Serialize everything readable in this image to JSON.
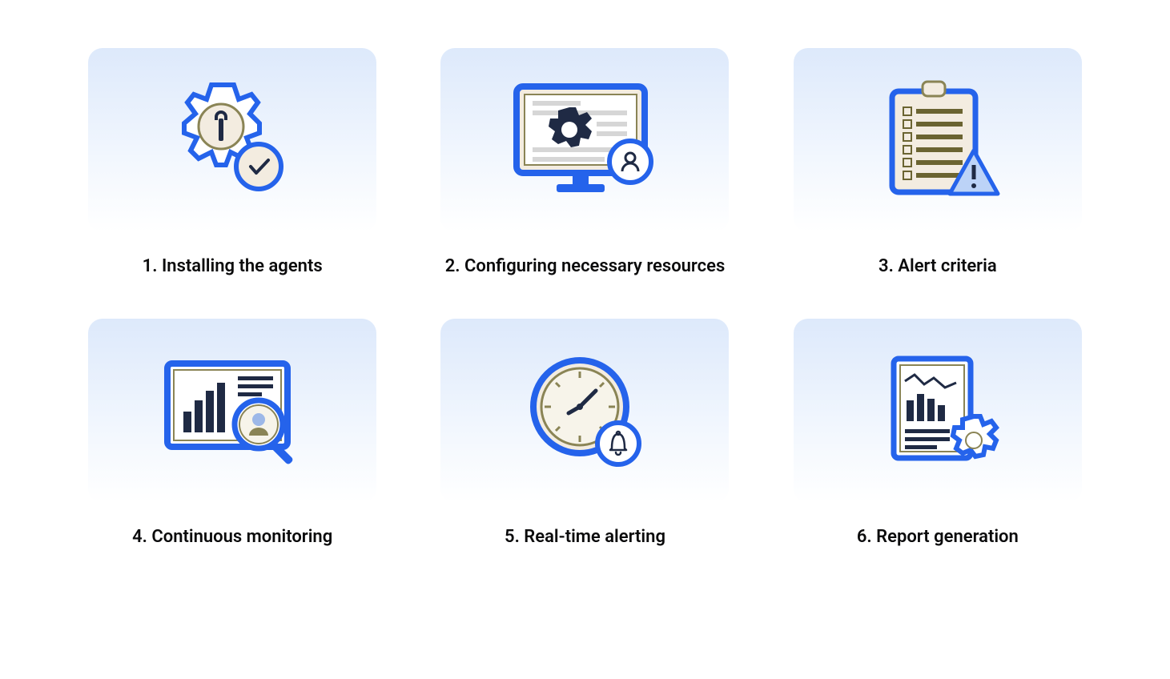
{
  "steps": [
    {
      "label": "1. Installing the agents"
    },
    {
      "label": "2. Configuring necessary resources"
    },
    {
      "label": "3. Alert criteria"
    },
    {
      "label": "4. Continuous monitoring"
    },
    {
      "label": "5. Real-time alerting"
    },
    {
      "label": "6. Report generation"
    }
  ],
  "colors": {
    "blue": "#2563eb",
    "darkNavy": "#1f2a44",
    "olive": "#8a8455",
    "cream": "#f3ece0",
    "lightBlue": "#bcd3f7",
    "white": "#ffffff"
  }
}
